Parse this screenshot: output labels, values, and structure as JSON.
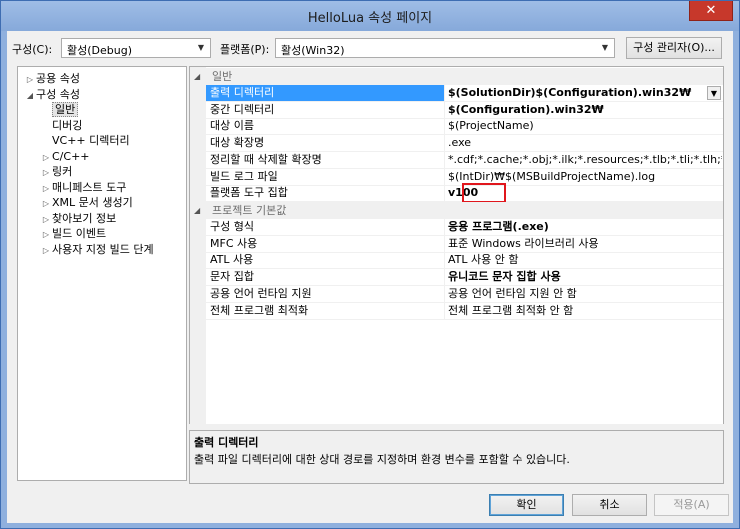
{
  "window": {
    "title": "HelloLua 속성 페이지",
    "close": "✕"
  },
  "top": {
    "config_label": "구성(C):",
    "config_value": "활성(Debug)",
    "platform_label": "플랫폼(P):",
    "platform_value": "활성(Win32)",
    "manager_button": "구성 관리자(O)..."
  },
  "tree": [
    {
      "label": "공용 속성",
      "expander": "▷",
      "level": 0
    },
    {
      "label": "구성 속성",
      "expander": "◢",
      "level": 0
    },
    {
      "label": "일반",
      "expander": "",
      "level": 1,
      "selected": true
    },
    {
      "label": "디버깅",
      "expander": "",
      "level": 1
    },
    {
      "label": "VC++ 디렉터리",
      "expander": "",
      "level": 1
    },
    {
      "label": "C/C++",
      "expander": "▷",
      "level": 1
    },
    {
      "label": "링커",
      "expander": "▷",
      "level": 1
    },
    {
      "label": "매니페스트 도구",
      "expander": "▷",
      "level": 1
    },
    {
      "label": "XML 문서 생성기",
      "expander": "▷",
      "level": 1
    },
    {
      "label": "찾아보기 정보",
      "expander": "▷",
      "level": 1
    },
    {
      "label": "빌드 이벤트",
      "expander": "▷",
      "level": 1
    },
    {
      "label": "사용자 지정 빌드 단계",
      "expander": "▷",
      "level": 1
    }
  ],
  "grid": {
    "cat_general": {
      "label": "일반",
      "expander": "◢"
    },
    "general_rows": [
      {
        "key": "출력 디렉터리",
        "value": "$(SolutionDir)$(Configuration).win32₩",
        "bold": true,
        "active": true
      },
      {
        "key": "중간 디렉터리",
        "value": "$(Configuration).win32₩",
        "bold": true
      },
      {
        "key": "대상 이름",
        "value": "$(ProjectName)"
      },
      {
        "key": "대상 확장명",
        "value": ".exe"
      },
      {
        "key": "정리할 때 삭제할 확장명",
        "value": "*.cdf;*.cache;*.obj;*.ilk;*.resources;*.tlb;*.tli;*.tlh;*.tmp;*.rsp;"
      },
      {
        "key": "빌드 로그 파일",
        "value": "$(IntDir)₩$(MSBuildProjectName).log"
      },
      {
        "key": "플랫폼 도구 집합",
        "value": "v100",
        "bold": true,
        "highlight": true
      }
    ],
    "cat_defaults": {
      "label": "프로젝트 기본값",
      "expander": "◢"
    },
    "default_rows": [
      {
        "key": "구성 형식",
        "value": "응용 프로그램(.exe)",
        "bold": true
      },
      {
        "key": "MFC 사용",
        "value": "표준 Windows 라이브러리 사용"
      },
      {
        "key": "ATL 사용",
        "value": "ATL 사용 안 함"
      },
      {
        "key": "문자 집합",
        "value": "유니코드 문자 집합 사용",
        "bold": true
      },
      {
        "key": "공용 언어 런타임 지원",
        "value": "공용 언어 런타임 지원 안 함"
      },
      {
        "key": "전체 프로그램 최적화",
        "value": "전체 프로그램 최적화 안 함"
      }
    ]
  },
  "description": {
    "title": "출력 디렉터리",
    "text": "출력 파일 디렉터리에 대한 상대 경로를 지정하며 환경 변수를 포함할 수 있습니다."
  },
  "buttons": {
    "ok": "확인",
    "cancel": "취소",
    "apply": "적용(A)"
  },
  "icons": {
    "dropdown": "chevron-down-icon",
    "expand": "triangle-icon"
  }
}
